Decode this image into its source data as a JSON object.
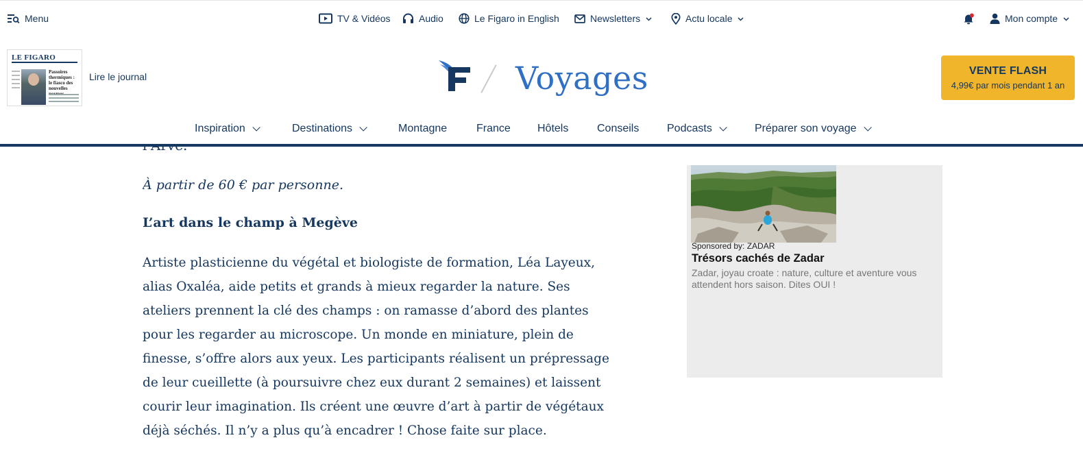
{
  "topbar": {
    "menu_label": "Menu",
    "tv_label": "TV & Vidéos",
    "audio_label": "Audio",
    "english_label": "Le Figaro in English",
    "newsletters_label": "Newsletters",
    "actu_label": "Actu locale",
    "account_label": "Mon compte",
    "notification_dot_color": "#e0252d"
  },
  "header": {
    "journal_masthead": "LE FIGARO",
    "journal_headline": "Passoires thermiques : le fiasco des nouvelles normes",
    "journal_link": "Lire le journal",
    "section_title": "Voyages",
    "flash_title": "VENTE FLASH",
    "flash_subtitle": "4,99€ par mois pendant 1 an",
    "flash_color": "#f0b52a",
    "brand_color": "#163860",
    "accent_color": "#2f6fc4"
  },
  "nav": {
    "items": [
      {
        "label": "Inspiration",
        "dropdown": true
      },
      {
        "label": "Destinations",
        "dropdown": true
      },
      {
        "label": "Montagne",
        "dropdown": false
      },
      {
        "label": "France",
        "dropdown": false
      },
      {
        "label": "Hôtels",
        "dropdown": false
      },
      {
        "label": "Conseils",
        "dropdown": false
      },
      {
        "label": "Podcasts",
        "dropdown": true
      },
      {
        "label": "Préparer son voyage",
        "dropdown": true
      }
    ]
  },
  "article": {
    "cutoff_text": "l'Arve.",
    "price_text": "À partir de 60 € par personne.",
    "subheading": "L’art dans le champ à Megève",
    "body_lines": [
      "Artiste plasticienne du végétal et biologiste de formation, Léa Layeux,",
      "alias Oxaléa, aide petits et grands à mieux regarder la nature. Ses",
      "ateliers prennent la clé des champs : on ramasse d’abord des plantes",
      "pour les regarder au microscope. Un monde en miniature, plein de",
      "finesse, s’offre alors aux yeux. Les participants réalisent un prépressage",
      "de leur cueillette (à poursuivre chez eux durant 2 semaines) et laissent",
      "courir leur imagination. Ils créent une œuvre d’art à partir de végétaux",
      "déjà séchés. Il n’y a plus qu’à encadrer ! Chose faite sur place."
    ]
  },
  "ad": {
    "sponsor": "Sponsored by: ZADAR",
    "title": "Trésors cachés de Zadar",
    "description": "Zadar, joyau croate : nature, culture et aventure vous attendent hors saison. Dites OUI !"
  }
}
